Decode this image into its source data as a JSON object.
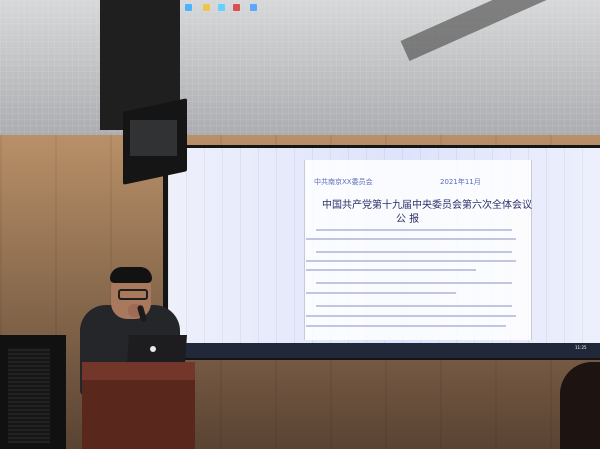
{
  "scene": {
    "document_header_left": "中共南京XX委员会",
    "document_header_right": "2021年11月",
    "document_title_line1": "中国共产党第十九届中央委员会第六次全体会议",
    "document_title_line2": "公 报",
    "clock": "11:25"
  }
}
